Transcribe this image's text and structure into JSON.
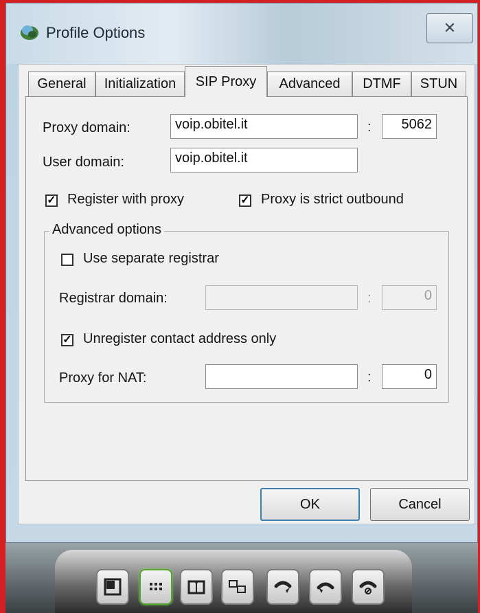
{
  "window": {
    "title": "Profile Options",
    "close_glyph": "✕"
  },
  "tabs": [
    {
      "label": "General"
    },
    {
      "label": "Initialization"
    },
    {
      "label": "SIP Proxy"
    },
    {
      "label": "Advanced"
    },
    {
      "label": "DTMF"
    },
    {
      "label": "STUN"
    }
  ],
  "active_tab": "SIP Proxy",
  "sip": {
    "proxy_domain_label": "Proxy domain:",
    "proxy_domain_value": "voip.obitel.it",
    "proxy_port_value": "5062",
    "user_domain_label": "User domain:",
    "user_domain_value": "voip.obitel.it",
    "register_label": "Register with proxy",
    "register_checked": true,
    "strict_label": "Proxy is strict outbound",
    "strict_checked": true,
    "colon": ":"
  },
  "advanced": {
    "group_title": "Advanced options",
    "separate_registrar_label": "Use separate registrar",
    "separate_registrar_checked": false,
    "registrar_domain_label": "Registrar domain:",
    "registrar_domain_value": "",
    "registrar_port_value": "0",
    "unregister_label": "Unregister contact address only",
    "unregister_checked": true,
    "nat_proxy_label": "Proxy for NAT:",
    "nat_proxy_value": "",
    "nat_port_value": "0"
  },
  "buttons": {
    "ok": "OK",
    "cancel": "Cancel"
  },
  "check_glyph": "✓",
  "toolbar_icons": [
    "window-icon",
    "keypad-icon",
    "phonebook-icon",
    "transfer-icon",
    "call-icon",
    "hold-icon",
    "hangup-icon"
  ],
  "colors": {
    "frame_red": "#d42020",
    "tab_bg": "#f0f0f0",
    "default_button_border": "#3c7fb1"
  }
}
